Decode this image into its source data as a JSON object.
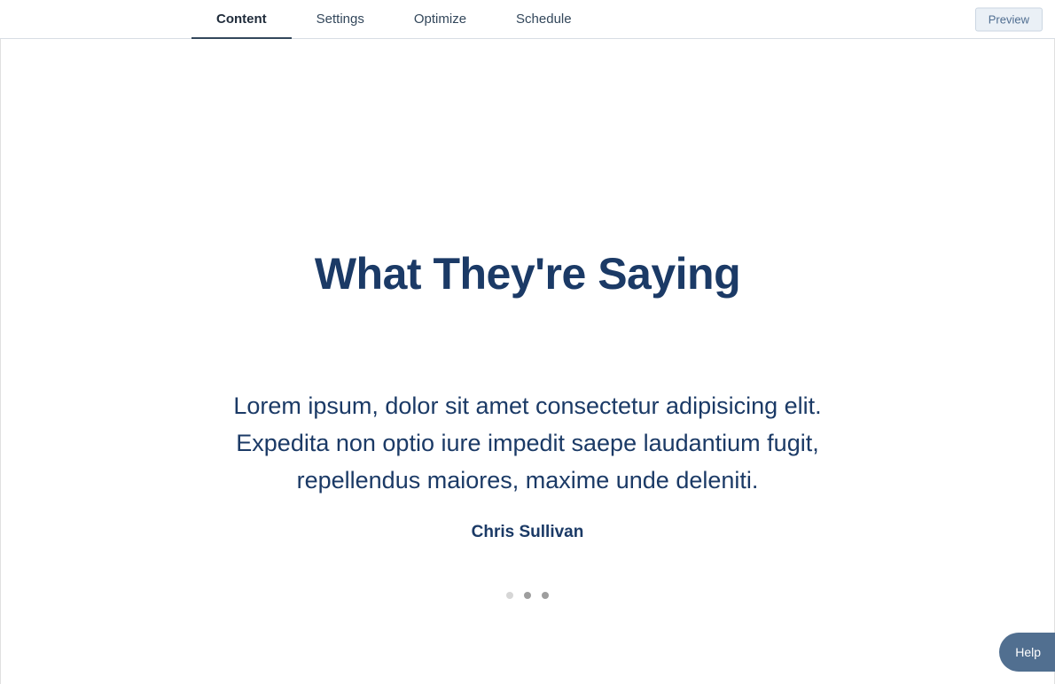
{
  "nav": {
    "tabs": [
      {
        "label": "Content",
        "active": true
      },
      {
        "label": "Settings",
        "active": false
      },
      {
        "label": "Optimize",
        "active": false
      },
      {
        "label": "Schedule",
        "active": false
      }
    ],
    "preview_label": "Preview"
  },
  "testimonial": {
    "heading": "What They're Saying",
    "body": "Lorem ipsum, dolor sit amet consectetur adipisicing elit. Expedita non optio iure impedit saepe laudantium fugit, repellendus maiores, maxime unde deleniti.",
    "author": "Chris Sullivan",
    "slide_count": 3,
    "active_slide_index": 1
  },
  "help": {
    "label": "Help"
  },
  "colors": {
    "brand_dark_blue": "#1b3a66",
    "chip_bg": "#516f90",
    "tab_underline": "#33475b",
    "preview_bg": "#eaf0f6",
    "preview_border": "#cbd6e2"
  }
}
